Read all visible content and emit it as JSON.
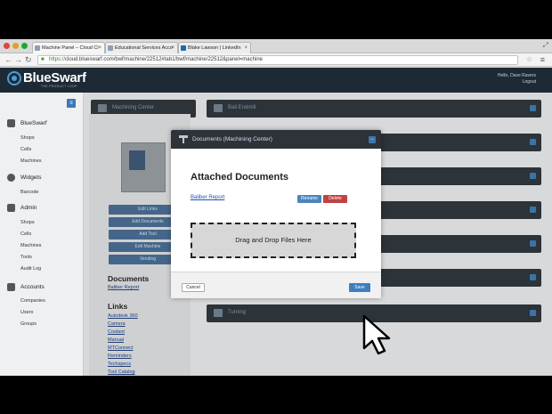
{
  "browser": {
    "tabs": [
      {
        "label": "Machine Panel – Cloud Cl",
        "active": true
      },
      {
        "label": "Educational Services Acco",
        "active": false
      },
      {
        "label": "Blake Lawson | LinkedIn",
        "active": false
      }
    ],
    "url_scheme": "https://",
    "url_rest": "cloud.blueswarf.com/bwf/machine/22512#tab1/bwf/machine/22512&panel=machine"
  },
  "app": {
    "logo": "BlueSwarf",
    "logo_tagline": "THE PRODUCT LOOP",
    "greeting": "Hello, Dave Ravers",
    "logout": "Logout"
  },
  "sidebar": {
    "sections": [
      {
        "label": "BlueSwarf",
        "icon": "house-icon",
        "items": [
          "Shops",
          "Cells",
          "Machines"
        ]
      },
      {
        "label": "Widgets",
        "icon": "gear-icon",
        "items": [
          "Barcode"
        ]
      },
      {
        "label": "Admin",
        "icon": "user-icon",
        "items": [
          "Shops",
          "Cells",
          "Machines",
          "Tools",
          "Audit Log"
        ]
      },
      {
        "label": "Accounts",
        "icon": "users-icon",
        "items": [
          "Companies",
          "Users",
          "Groups"
        ]
      }
    ]
  },
  "main": {
    "machine_panel_title": "Machining Center",
    "side_buttons": [
      "Edit Links",
      "Edit Documents",
      "Add Tool",
      "Edit Machine",
      "Vending"
    ],
    "documents_title": "Documents",
    "documents": [
      "Baliber Report"
    ],
    "links_title": "Links",
    "links": [
      "Autodesk 360",
      "Camera",
      "Coolant",
      "Manual",
      "MTConnect",
      "Reminders",
      "Techspecs",
      "Tool Catalog"
    ],
    "right_panels": [
      "Ball Endmill",
      "",
      "",
      "",
      "",
      "",
      "Turning"
    ]
  },
  "modal": {
    "title": "Documents (Machining Center)",
    "heading": "Attached Documents",
    "document_link": "Baliber Report",
    "rename": "Rename",
    "delete": "Delete",
    "dropzone": "Drag and Drop Files Here",
    "cancel": "Cancel",
    "save": "Save"
  }
}
